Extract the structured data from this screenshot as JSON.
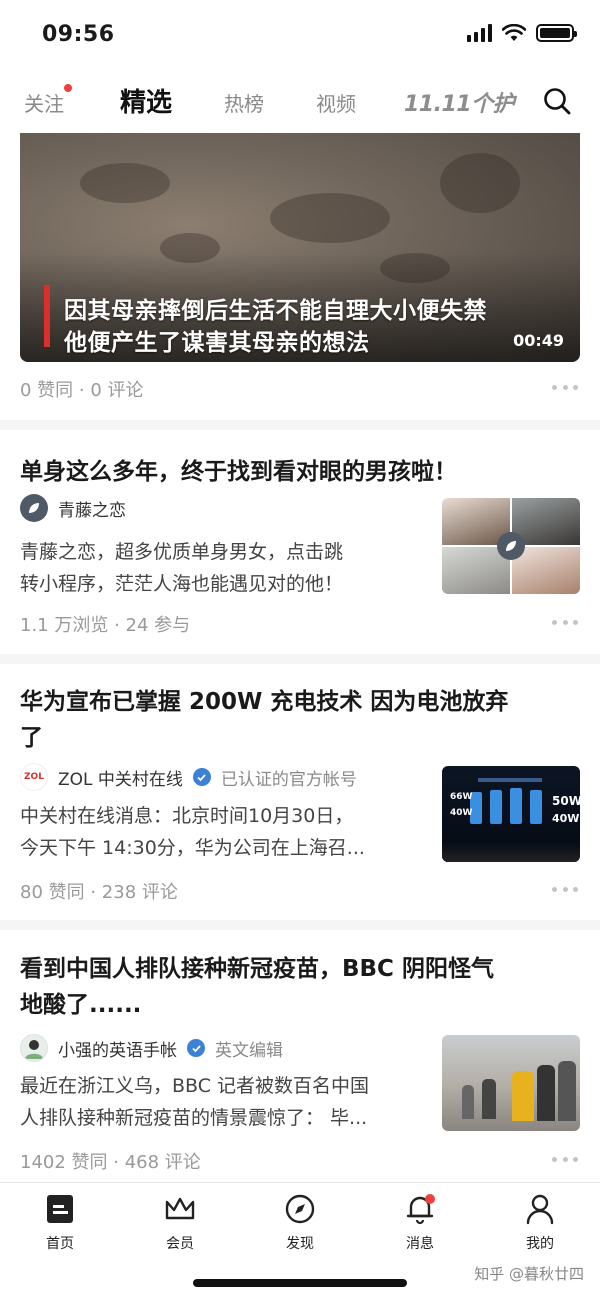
{
  "status_bar": {
    "time": "09:56"
  },
  "top_nav": {
    "tabs": [
      {
        "label": "关注",
        "has_dot": true
      },
      {
        "label": "精选",
        "active": true
      },
      {
        "label": "热榜"
      },
      {
        "label": "视频"
      }
    ],
    "promo_label": "11.11个护"
  },
  "feed": [
    {
      "type": "video",
      "caption_line1": "因其母亲摔倒后生活不能自理大小便失禁",
      "caption_line2": "他便产生了谋害其母亲的想法",
      "duration": "00:49",
      "meta": "0 赞同 · 0 评论"
    },
    {
      "type": "ad",
      "title": "单身这么多年，终于找到看对眼的男孩啦！",
      "author": "青藤之恋",
      "excerpt_line1": "青藤之恋，超多优质单身男女，点击跳",
      "excerpt_line2": "转小程序，茫茫人海也能遇见对的他！",
      "meta": "1.1 万浏览 · 24 参与"
    },
    {
      "type": "article",
      "title_line1": "华为宣布已掌握 200W 充电技术 因为电池放弃",
      "title_line2": "了",
      "author": "ZOL 中关村在线",
      "author_logo": "ZOL",
      "author_tag": "已认证的官方帐号",
      "excerpt_line1": "中关村在线消息：北京时间10月30日，",
      "excerpt_line2": "今天下午 14:30分，华为公司在上海召...",
      "thumb_labels": [
        "66W",
        "40W",
        "50W",
        "40W"
      ],
      "meta": "80 赞同 · 238 评论"
    },
    {
      "type": "article",
      "title_line1": "看到中国人排队接种新冠疫苗，BBC 阴阳怪气",
      "title_line2": "地酸了......",
      "author": "小强的英语手帐",
      "author_tag": "英文编辑",
      "excerpt_line1": "最近在浙江义乌，BBC 记者被数百名中国",
      "excerpt_line2": "人排队接种新冠疫苗的情景震惊了：  毕...",
      "meta": "1402 赞同 · 468 评论"
    }
  ],
  "bottom_nav": [
    {
      "label": "首页",
      "icon": "home-icon"
    },
    {
      "label": "会员",
      "icon": "crown-icon"
    },
    {
      "label": "发现",
      "icon": "compass-icon"
    },
    {
      "label": "消息",
      "icon": "bell-icon",
      "has_dot": true
    },
    {
      "label": "我的",
      "icon": "person-icon"
    }
  ],
  "watermark": "知乎 @暮秋廿四",
  "colors": {
    "accent_red": "#f1403c",
    "verified_blue": "#3b82d6",
    "text_primary": "#1a1a1a",
    "text_meta": "#9a9a9a"
  }
}
